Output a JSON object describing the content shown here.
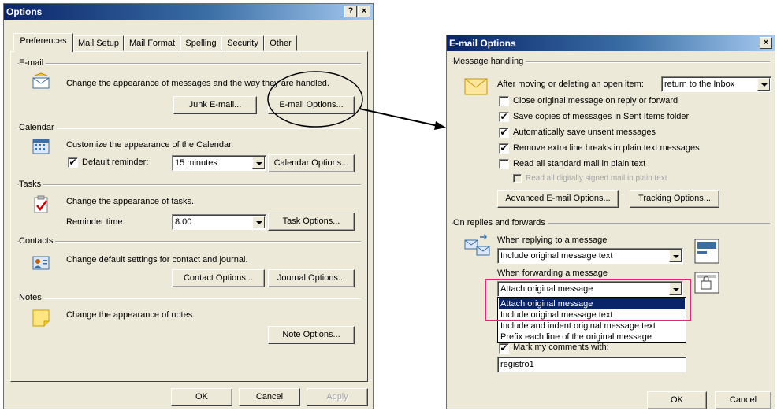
{
  "options_dialog": {
    "title": "Options",
    "help_btn": "?",
    "close_btn": "×",
    "tabs": [
      "Preferences",
      "Mail Setup",
      "Mail Format",
      "Spelling",
      "Security",
      "Other"
    ],
    "email": {
      "section": "E-mail",
      "description": "Change the appearance of messages and the way they are handled.",
      "junk_button": "Junk E-mail...",
      "options_button": "E-mail Options..."
    },
    "calendar": {
      "section": "Calendar",
      "description": "Customize the appearance of the Calendar.",
      "reminder_label": "Default reminder:",
      "reminder_value": "15 minutes",
      "reminder_checked": "✔",
      "options_button": "Calendar Options..."
    },
    "tasks": {
      "section": "Tasks",
      "description": "Change the appearance of tasks.",
      "reminder_label": "Reminder time:",
      "reminder_value": "8.00",
      "options_button": "Task Options..."
    },
    "contacts": {
      "section": "Contacts",
      "description": "Change default settings for contact and journal.",
      "contact_button": "Contact Options...",
      "journal_button": "Journal Options..."
    },
    "notes": {
      "section": "Notes",
      "description": "Change the appearance of notes.",
      "options_button": "Note Options..."
    },
    "footer": {
      "ok": "OK",
      "cancel": "Cancel",
      "apply": "Apply"
    }
  },
  "email_options_dialog": {
    "title": "E-mail Options",
    "close_btn": "×",
    "message_handling": {
      "section": "Message handling",
      "after_moving_label": "After moving or deleting an open item:",
      "after_moving_value": "return to the Inbox",
      "checkboxes": [
        {
          "label": "Close original message on reply or forward",
          "mark": ""
        },
        {
          "label": "Save copies of messages in Sent Items folder",
          "mark": "✔"
        },
        {
          "label": "Automatically save unsent messages",
          "mark": "✔"
        },
        {
          "label": "Remove extra line breaks in plain text messages",
          "mark": "✔"
        },
        {
          "label": "Read all standard mail in plain text",
          "mark": ""
        }
      ],
      "disabled_checkbox_label": "Read all digitally signed mail in plain text",
      "advanced_button": "Advanced E-mail Options...",
      "tracking_button": "Tracking Options..."
    },
    "replies": {
      "section": "On replies and forwards",
      "replying_label": "When replying to a message",
      "replying_value": "Include original message text",
      "forwarding_label": "When forwarding a message",
      "forwarding_value": "Attach original message",
      "dropdown_options": [
        "Attach original message",
        "Include original message text",
        "Include and indent original message text",
        "Prefix each line of the original message"
      ],
      "mark_comments_label": "Mark my comments with:",
      "mark_comments_checked": "✔",
      "mark_comments_value": "registro1"
    },
    "footer": {
      "ok": "OK",
      "cancel": "Cancel"
    }
  },
  "colors": {
    "highlight_box": "#e0257a",
    "selection": "#0a246a",
    "dialog_bg": "#ece9d8"
  }
}
